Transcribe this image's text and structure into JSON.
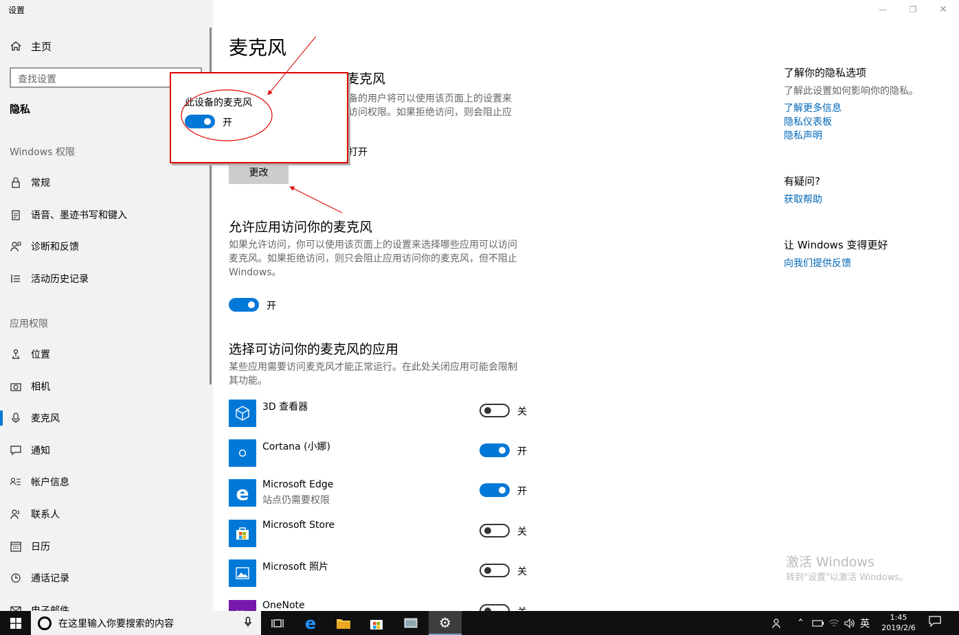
{
  "window": {
    "title": "设置"
  },
  "sidebar": {
    "home": "主页",
    "search_placeholder": "查找设置",
    "current": "隐私",
    "section_windows": "Windows 权限",
    "windows_items": [
      {
        "label": "常规",
        "icon": "lock-icon"
      },
      {
        "label": "语音、墨迹书写和键入",
        "icon": "clipboard-icon"
      },
      {
        "label": "诊断和反馈",
        "icon": "person-feedback-icon"
      },
      {
        "label": "活动历史记录",
        "icon": "timeline-icon"
      }
    ],
    "section_apps": "应用权限",
    "app_items": [
      {
        "label": "位置",
        "icon": "location-icon"
      },
      {
        "label": "相机",
        "icon": "camera-icon"
      },
      {
        "label": "麦克风",
        "icon": "microphone-icon"
      },
      {
        "label": "通知",
        "icon": "notification-icon"
      },
      {
        "label": "帐户信息",
        "icon": "account-info-icon"
      },
      {
        "label": "联系人",
        "icon": "contacts-icon"
      },
      {
        "label": "日历",
        "icon": "calendar-icon"
      },
      {
        "label": "通话记录",
        "icon": "call-history-icon"
      },
      {
        "label": "电子邮件",
        "icon": "mail-icon"
      }
    ]
  },
  "main": {
    "title": "麦克风",
    "device_heading": "允许在此设备上访问麦克风",
    "device_desc_tail": "备的用户将可以使用该页面上的设置来",
    "device_desc_tail2": "访问权限。如果拒绝访问，则会阻止应",
    "device_status_tail": "打开",
    "change_button": "更改",
    "apps_heading": "允许应用访问你的麦克风",
    "apps_desc": "如果允许访问，你可以使用该页面上的设置来选择哪些应用可以访问麦克风。如果拒绝访问，则只会阻止应用访问你的麦克风，但不阻止 Windows。",
    "apps_toggle_label": "开",
    "choose_heading": "选择可访问你的麦克风的应用",
    "choose_desc": "某些应用需要访问麦克风才能正常运行。在此处关闭应用可能会限制其功能。",
    "apps": [
      {
        "name": "3D 查看器",
        "sub": "",
        "state": "关",
        "on": false,
        "icon": "cube-icon"
      },
      {
        "name": "Cortana (小娜)",
        "sub": "",
        "state": "开",
        "on": true,
        "icon": "cortana-icon"
      },
      {
        "name": "Microsoft Edge",
        "sub": "站点仍需要权限",
        "state": "开",
        "on": true,
        "icon": "edge-icon"
      },
      {
        "name": "Microsoft Store",
        "sub": "",
        "state": "关",
        "on": false,
        "icon": "store-icon"
      },
      {
        "name": "Microsoft 照片",
        "sub": "",
        "state": "关",
        "on": false,
        "icon": "photos-icon"
      },
      {
        "name": "OneNote",
        "sub": "",
        "state": "关",
        "on": false,
        "icon": "onenote-icon"
      }
    ]
  },
  "popup": {
    "title": "此设备的麦克风",
    "toggle_label": "开"
  },
  "right": {
    "privacy_heading": "了解你的隐私选项",
    "privacy_desc": "了解此设置如何影响你的隐私。",
    "links": [
      "了解更多信息",
      "隐私仪表板",
      "隐私声明"
    ],
    "question_heading": "有疑问?",
    "help_link": "获取帮助",
    "improve_heading": "让 Windows 变得更好",
    "feedback_link": "向我们提供反馈"
  },
  "watermark": {
    "line1": "激活 Windows",
    "line2": "转到\"设置\"以激活 Windows。"
  },
  "taskbar": {
    "search_placeholder": "在这里输入你要搜索的内容",
    "ime": "英",
    "time": "1:45",
    "date": "2019/2/6"
  },
  "colors": {
    "accent": "#0078d7",
    "link": "#0067b8",
    "annotation": "#d00000"
  }
}
